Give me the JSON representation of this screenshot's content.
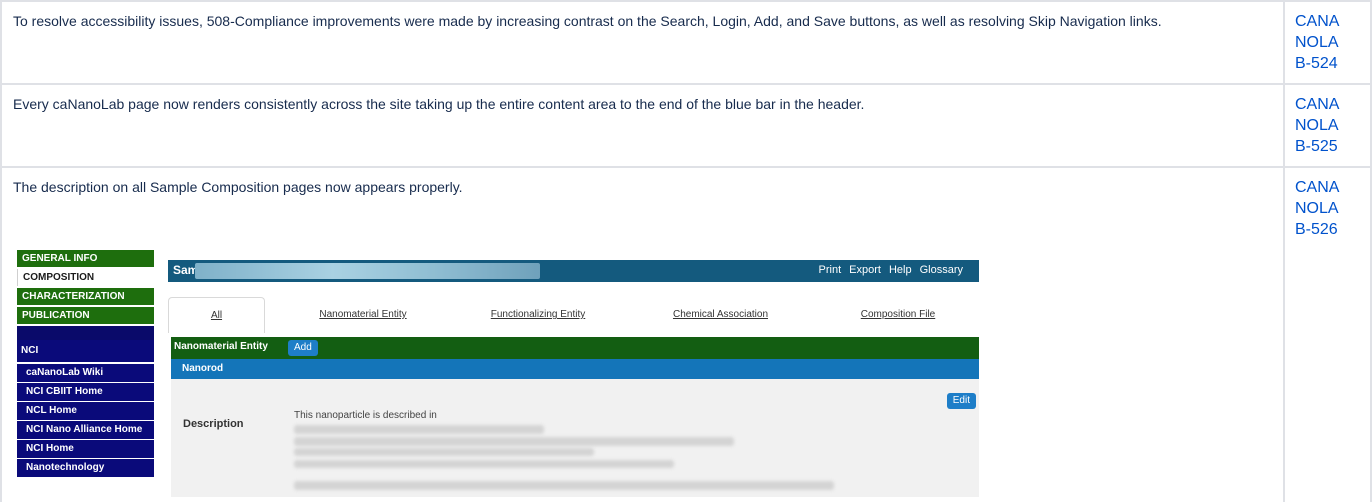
{
  "rows": [
    {
      "description": "To resolve accessibility issues, 508-Compliance improvements were made by increasing contrast on the Search, Login, Add, and Save buttons, as well as resolving Skip Navigation links.",
      "ticket": "CANANOLAB-524"
    },
    {
      "description": "Every caNanoLab page now renders consistently across the site taking up the entire content area to the end of the blue bar in the header.",
      "ticket": "CANANOLAB-525"
    },
    {
      "description": "The description on all Sample Composition pages now appears properly.",
      "ticket": "CANANOLAB-526"
    }
  ],
  "screenshot": {
    "nav": {
      "general_info": "GENERAL INFO",
      "composition": "COMPOSITION",
      "characterization": "CHARACTERIZATION",
      "publication": "PUBLICATION",
      "nci": "NCI",
      "links": [
        "caNanoLab Wiki",
        "NCI CBIIT Home",
        "NCL Home",
        "NCI Nano Alliance Home",
        "NCI Home",
        "Nanotechnology"
      ]
    },
    "header": {
      "title": "Sample",
      "links": [
        "Print",
        "Export",
        "Help",
        "Glossary"
      ]
    },
    "tabs": [
      "All",
      "Nanomaterial Entity",
      "Functionalizing Entity",
      "Chemical Association",
      "Composition File"
    ],
    "section_title": "Nanomaterial Entity",
    "add_label": "Add",
    "subsection_title": "Nanorod",
    "edit_label": "Edit",
    "description_label": "Description",
    "description_text": "This nanoparticle is described in"
  },
  "colors": {
    "link": "#0052cc",
    "nav_green": "#1e6e0d",
    "nav_navy": "#0a0a7a",
    "header_teal": "#145a7e",
    "section_green": "#135e12",
    "section_blue": "#1475b9",
    "button_blue": "#1e7ec8"
  }
}
